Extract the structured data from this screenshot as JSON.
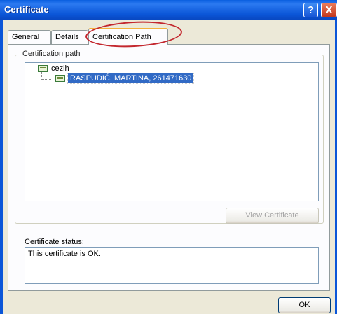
{
  "window": {
    "title": "Certificate"
  },
  "titlebar": {
    "help_symbol": "?",
    "close_symbol": "X",
    "help_icon": "help-icon",
    "close_icon": "close-icon"
  },
  "tabs": [
    {
      "label": "General",
      "active": false
    },
    {
      "label": "Details",
      "active": false
    },
    {
      "label": "Certification Path",
      "active": true
    }
  ],
  "path_group": {
    "legend": "Certification path",
    "tree": [
      {
        "label": "cezih",
        "icon": "certificate-icon",
        "selected": false
      },
      {
        "label": "RASPUDIĆ, MARTINA, 261471630",
        "icon": "certificate-icon",
        "selected": true
      }
    ]
  },
  "view_button": {
    "label": "View Certificate",
    "enabled": false
  },
  "status": {
    "label": "Certificate status:",
    "value": "This certificate is OK."
  },
  "ok_button": {
    "label": "OK"
  },
  "colors": {
    "titlebar": "#0b56d8",
    "selection": "#316ac5",
    "annotation": "#c3272e",
    "dialog_bg": "#ece9d8"
  }
}
